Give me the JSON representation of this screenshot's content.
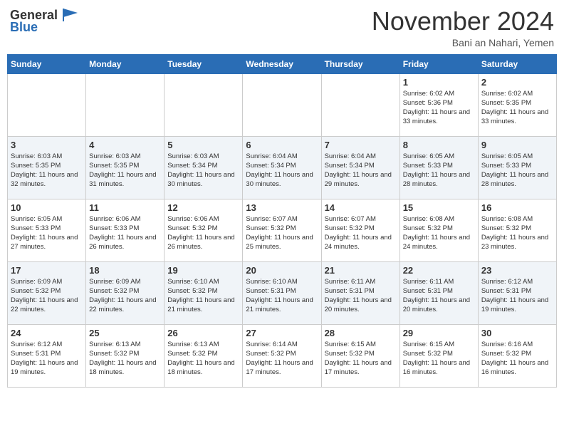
{
  "header": {
    "logo_general": "General",
    "logo_blue": "Blue",
    "month_title": "November 2024",
    "location": "Bani an Nahari, Yemen"
  },
  "days_of_week": [
    "Sunday",
    "Monday",
    "Tuesday",
    "Wednesday",
    "Thursday",
    "Friday",
    "Saturday"
  ],
  "weeks": [
    [
      {
        "day": "",
        "sunrise": "",
        "sunset": "",
        "daylight": ""
      },
      {
        "day": "",
        "sunrise": "",
        "sunset": "",
        "daylight": ""
      },
      {
        "day": "",
        "sunrise": "",
        "sunset": "",
        "daylight": ""
      },
      {
        "day": "",
        "sunrise": "",
        "sunset": "",
        "daylight": ""
      },
      {
        "day": "",
        "sunrise": "",
        "sunset": "",
        "daylight": ""
      },
      {
        "day": "1",
        "sunrise": "Sunrise: 6:02 AM",
        "sunset": "Sunset: 5:36 PM",
        "daylight": "Daylight: 11 hours and 33 minutes."
      },
      {
        "day": "2",
        "sunrise": "Sunrise: 6:02 AM",
        "sunset": "Sunset: 5:35 PM",
        "daylight": "Daylight: 11 hours and 33 minutes."
      }
    ],
    [
      {
        "day": "3",
        "sunrise": "Sunrise: 6:03 AM",
        "sunset": "Sunset: 5:35 PM",
        "daylight": "Daylight: 11 hours and 32 minutes."
      },
      {
        "day": "4",
        "sunrise": "Sunrise: 6:03 AM",
        "sunset": "Sunset: 5:35 PM",
        "daylight": "Daylight: 11 hours and 31 minutes."
      },
      {
        "day": "5",
        "sunrise": "Sunrise: 6:03 AM",
        "sunset": "Sunset: 5:34 PM",
        "daylight": "Daylight: 11 hours and 30 minutes."
      },
      {
        "day": "6",
        "sunrise": "Sunrise: 6:04 AM",
        "sunset": "Sunset: 5:34 PM",
        "daylight": "Daylight: 11 hours and 30 minutes."
      },
      {
        "day": "7",
        "sunrise": "Sunrise: 6:04 AM",
        "sunset": "Sunset: 5:34 PM",
        "daylight": "Daylight: 11 hours and 29 minutes."
      },
      {
        "day": "8",
        "sunrise": "Sunrise: 6:05 AM",
        "sunset": "Sunset: 5:33 PM",
        "daylight": "Daylight: 11 hours and 28 minutes."
      },
      {
        "day": "9",
        "sunrise": "Sunrise: 6:05 AM",
        "sunset": "Sunset: 5:33 PM",
        "daylight": "Daylight: 11 hours and 28 minutes."
      }
    ],
    [
      {
        "day": "10",
        "sunrise": "Sunrise: 6:05 AM",
        "sunset": "Sunset: 5:33 PM",
        "daylight": "Daylight: 11 hours and 27 minutes."
      },
      {
        "day": "11",
        "sunrise": "Sunrise: 6:06 AM",
        "sunset": "Sunset: 5:33 PM",
        "daylight": "Daylight: 11 hours and 26 minutes."
      },
      {
        "day": "12",
        "sunrise": "Sunrise: 6:06 AM",
        "sunset": "Sunset: 5:32 PM",
        "daylight": "Daylight: 11 hours and 26 minutes."
      },
      {
        "day": "13",
        "sunrise": "Sunrise: 6:07 AM",
        "sunset": "Sunset: 5:32 PM",
        "daylight": "Daylight: 11 hours and 25 minutes."
      },
      {
        "day": "14",
        "sunrise": "Sunrise: 6:07 AM",
        "sunset": "Sunset: 5:32 PM",
        "daylight": "Daylight: 11 hours and 24 minutes."
      },
      {
        "day": "15",
        "sunrise": "Sunrise: 6:08 AM",
        "sunset": "Sunset: 5:32 PM",
        "daylight": "Daylight: 11 hours and 24 minutes."
      },
      {
        "day": "16",
        "sunrise": "Sunrise: 6:08 AM",
        "sunset": "Sunset: 5:32 PM",
        "daylight": "Daylight: 11 hours and 23 minutes."
      }
    ],
    [
      {
        "day": "17",
        "sunrise": "Sunrise: 6:09 AM",
        "sunset": "Sunset: 5:32 PM",
        "daylight": "Daylight: 11 hours and 22 minutes."
      },
      {
        "day": "18",
        "sunrise": "Sunrise: 6:09 AM",
        "sunset": "Sunset: 5:32 PM",
        "daylight": "Daylight: 11 hours and 22 minutes."
      },
      {
        "day": "19",
        "sunrise": "Sunrise: 6:10 AM",
        "sunset": "Sunset: 5:32 PM",
        "daylight": "Daylight: 11 hours and 21 minutes."
      },
      {
        "day": "20",
        "sunrise": "Sunrise: 6:10 AM",
        "sunset": "Sunset: 5:31 PM",
        "daylight": "Daylight: 11 hours and 21 minutes."
      },
      {
        "day": "21",
        "sunrise": "Sunrise: 6:11 AM",
        "sunset": "Sunset: 5:31 PM",
        "daylight": "Daylight: 11 hours and 20 minutes."
      },
      {
        "day": "22",
        "sunrise": "Sunrise: 6:11 AM",
        "sunset": "Sunset: 5:31 PM",
        "daylight": "Daylight: 11 hours and 20 minutes."
      },
      {
        "day": "23",
        "sunrise": "Sunrise: 6:12 AM",
        "sunset": "Sunset: 5:31 PM",
        "daylight": "Daylight: 11 hours and 19 minutes."
      }
    ],
    [
      {
        "day": "24",
        "sunrise": "Sunrise: 6:12 AM",
        "sunset": "Sunset: 5:31 PM",
        "daylight": "Daylight: 11 hours and 19 minutes."
      },
      {
        "day": "25",
        "sunrise": "Sunrise: 6:13 AM",
        "sunset": "Sunset: 5:32 PM",
        "daylight": "Daylight: 11 hours and 18 minutes."
      },
      {
        "day": "26",
        "sunrise": "Sunrise: 6:13 AM",
        "sunset": "Sunset: 5:32 PM",
        "daylight": "Daylight: 11 hours and 18 minutes."
      },
      {
        "day": "27",
        "sunrise": "Sunrise: 6:14 AM",
        "sunset": "Sunset: 5:32 PM",
        "daylight": "Daylight: 11 hours and 17 minutes."
      },
      {
        "day": "28",
        "sunrise": "Sunrise: 6:15 AM",
        "sunset": "Sunset: 5:32 PM",
        "daylight": "Daylight: 11 hours and 17 minutes."
      },
      {
        "day": "29",
        "sunrise": "Sunrise: 6:15 AM",
        "sunset": "Sunset: 5:32 PM",
        "daylight": "Daylight: 11 hours and 16 minutes."
      },
      {
        "day": "30",
        "sunrise": "Sunrise: 6:16 AM",
        "sunset": "Sunset: 5:32 PM",
        "daylight": "Daylight: 11 hours and 16 minutes."
      }
    ]
  ]
}
